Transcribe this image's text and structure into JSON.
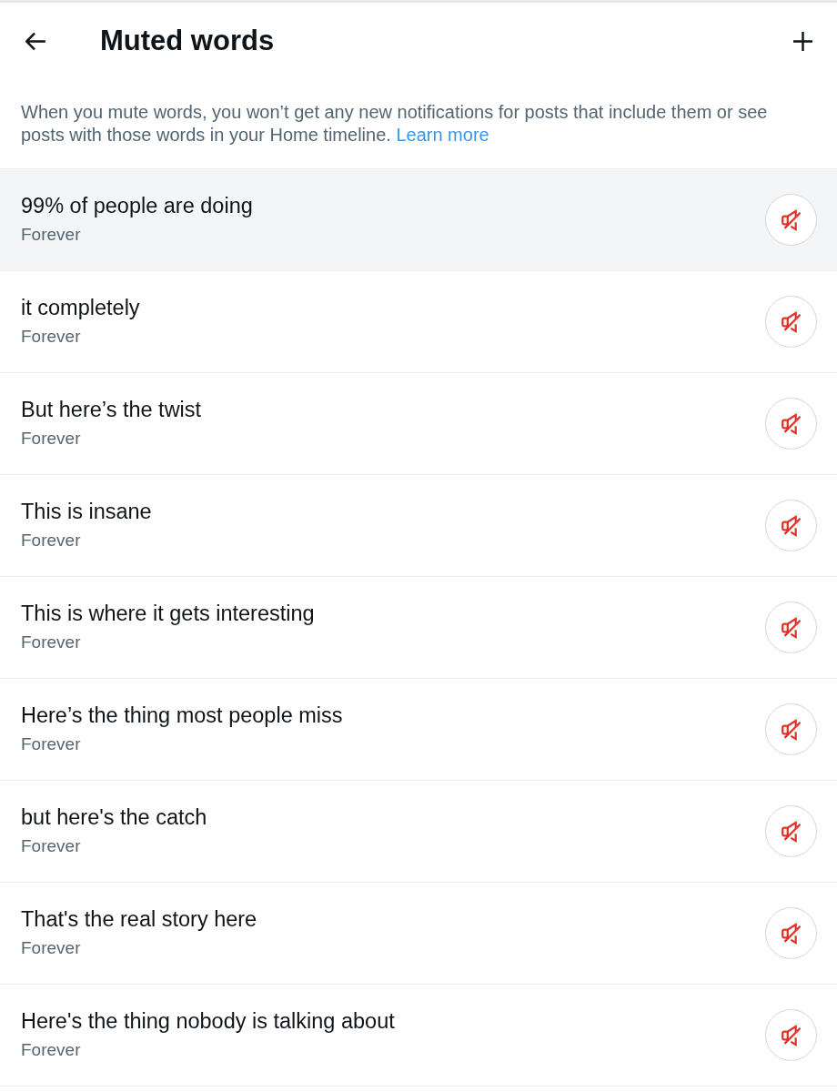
{
  "header": {
    "title": "Muted words"
  },
  "description": {
    "text": "When you mute words, you won’t get any new notifications for posts that include them or see posts with those words in your Home timeline.",
    "link": "Learn more"
  },
  "muted_words": [
    {
      "word": "99% of people are doing",
      "duration": "Forever",
      "highlighted": true
    },
    {
      "word": "it completely",
      "duration": "Forever",
      "highlighted": false
    },
    {
      "word": "But here’s the twist",
      "duration": "Forever",
      "highlighted": false
    },
    {
      "word": "This is insane",
      "duration": "Forever",
      "highlighted": false
    },
    {
      "word": "This is where it gets interesting",
      "duration": "Forever",
      "highlighted": false
    },
    {
      "word": "Here’s the thing most people miss",
      "duration": "Forever",
      "highlighted": false
    },
    {
      "word": "but here's the catch",
      "duration": "Forever",
      "highlighted": false
    },
    {
      "word": "That's the real story here",
      "duration": "Forever",
      "highlighted": false
    },
    {
      "word": "Here's the thing nobody is talking about",
      "duration": "Forever",
      "highlighted": false
    }
  ]
}
